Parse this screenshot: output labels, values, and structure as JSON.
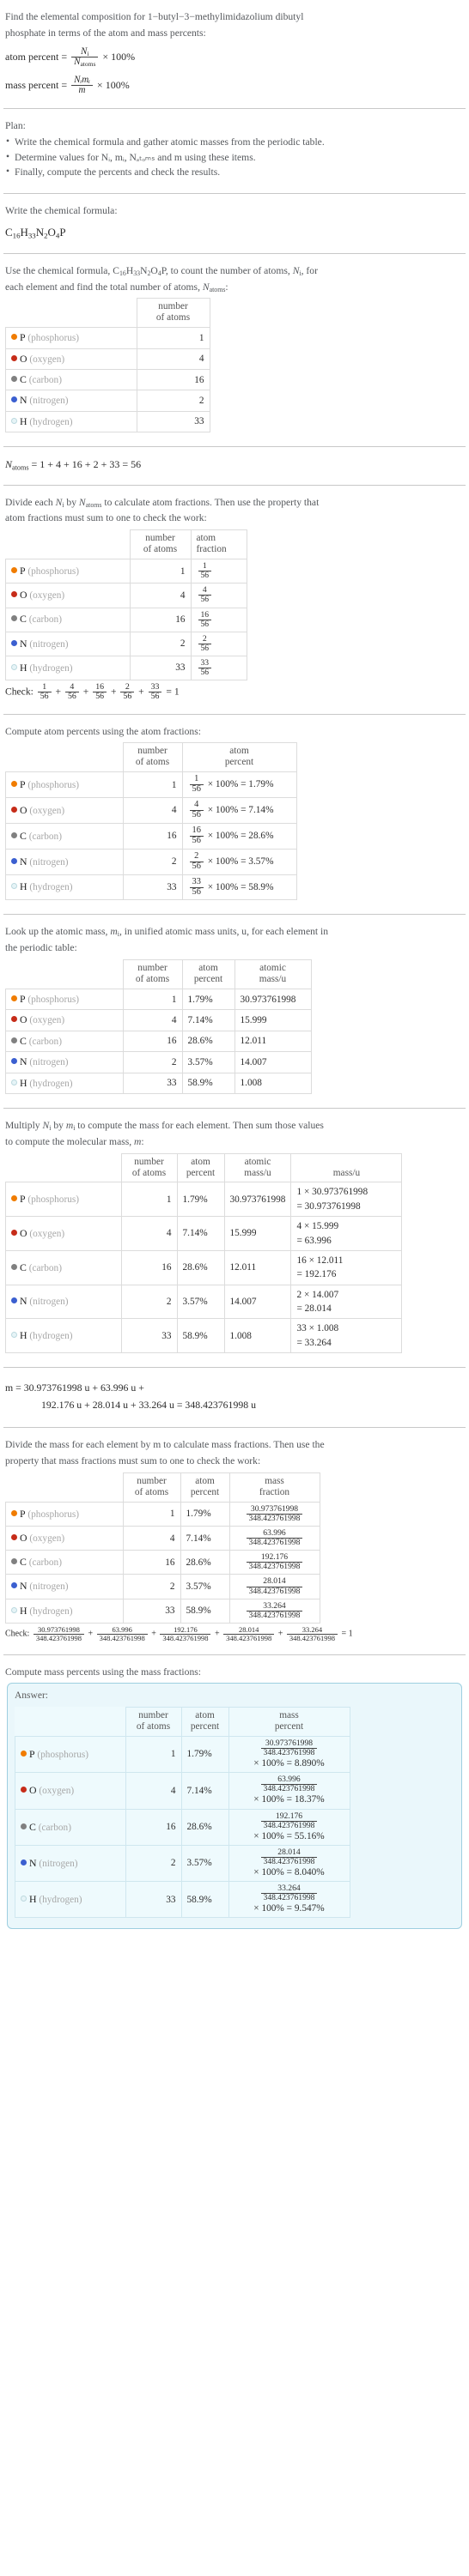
{
  "colors": {
    "phosphorus": "#f07c00",
    "oxygen": "#c62c19",
    "carbon": "#808080",
    "nitrogen": "#3b5fd0",
    "hydrogen": "#e6f4f7",
    "answer_border": "#9ecfe0",
    "answer_bg": "#eaf7fb"
  },
  "intro": {
    "line1": "Find the elemental composition for 1−butyl−3−methylimidazolium dibutyl",
    "line2": "phosphate in terms of the atom and mass percents:",
    "atom_percent_label": "atom percent",
    "mass_percent_label": "mass percent",
    "atom_percent_num": "N",
    "atom_percent_num_sub": "i",
    "atom_percent_den": "N",
    "atom_percent_den_sub": "atoms",
    "mass_percent_num": "Nᵢmᵢ",
    "mass_percent_den": "m",
    "times_100": "× 100%"
  },
  "plan": {
    "title": "Plan:",
    "items": [
      "Write the chemical formula and gather atomic masses from the periodic table.",
      "Determine values for Nᵢ, mᵢ, Nₐₜₒₘₛ and m using these items.",
      "Finally, compute the percents and check the results."
    ],
    "item2_parts": {
      "pre": "Determine values for ",
      "a": "N",
      "a_sub": "i",
      "b": "m",
      "b_sub": "i",
      "c": "N",
      "c_sub": "atoms",
      "mid": " and ",
      "d": "m",
      "post": " using these items."
    }
  },
  "formula_section": {
    "prompt": "Write the chemical formula:",
    "formula_parts": [
      {
        "el": "C",
        "n": "16"
      },
      {
        "el": "H",
        "n": "33"
      },
      {
        "el": "N",
        "n": "2"
      },
      {
        "el": "O",
        "n": "4"
      },
      {
        "el": "P",
        "n": ""
      }
    ],
    "formula_plain": "C16H33N2O4P"
  },
  "elements": [
    {
      "symbol": "P",
      "name": "(phosphorus)",
      "color": "#f07c00",
      "hollow": false,
      "count": "1",
      "fraction_num": "1",
      "atom_percent": "1.79%",
      "atomic_mass": "30.973761998",
      "mass_expr_mul": "1 × 30.973761998",
      "mass_expr_eq": "= 30.973761998",
      "mass_value": "30.973761998",
      "mass_percent_value": "8.890%"
    },
    {
      "symbol": "O",
      "name": "(oxygen)",
      "color": "#c62c19",
      "hollow": false,
      "count": "4",
      "fraction_num": "4",
      "atom_percent": "7.14%",
      "atomic_mass": "15.999",
      "mass_expr_mul": "4 × 15.999",
      "mass_expr_eq": "= 63.996",
      "mass_value": "63.996",
      "mass_percent_value": "18.37%"
    },
    {
      "symbol": "C",
      "name": "(carbon)",
      "color": "#808080",
      "hollow": false,
      "count": "16",
      "fraction_num": "16",
      "atom_percent": "28.6%",
      "atomic_mass": "12.011",
      "mass_expr_mul": "16 × 12.011",
      "mass_expr_eq": "= 192.176",
      "mass_value": "192.176",
      "mass_percent_value": "55.16%"
    },
    {
      "symbol": "N",
      "name": "(nitrogen)",
      "color": "#3b5fd0",
      "hollow": false,
      "count": "2",
      "fraction_num": "2",
      "atom_percent": "3.57%",
      "atomic_mass": "14.007",
      "mass_expr_mul": "2 × 14.007",
      "mass_expr_eq": "= 28.014",
      "mass_value": "28.014",
      "mass_percent_value": "8.040%"
    },
    {
      "symbol": "H",
      "name": "(hydrogen)",
      "color": "#e6f4f7",
      "hollow": true,
      "count": "33",
      "fraction_num": "33",
      "atom_percent": "58.9%",
      "atomic_mass": "1.008",
      "mass_expr_mul": "33 × 1.008",
      "mass_expr_eq": "= 33.264",
      "mass_value": "33.264",
      "mass_percent_value": "9.547%"
    }
  ],
  "denominator_atoms": "56",
  "total_mass": "348.423761998",
  "headers": {
    "number_of_atoms_l1": "number",
    "number_of_atoms_l2": "of atoms",
    "atom_fraction_l1": "atom",
    "atom_fraction_l2": "fraction",
    "atom_percent_l1": "atom",
    "atom_percent_l2": "percent",
    "atomic_mass_l1": "atomic",
    "atomic_mass_l2": "mass/u",
    "mass_u": "mass/u",
    "mass_fraction_l1": "mass",
    "mass_fraction_l2": "fraction",
    "mass_percent_l1": "mass",
    "mass_percent_l2": "percent"
  },
  "sections": {
    "count_prompt_l1": "Use the chemical formula, C16H33N2O4P, to count the number of atoms, Nᵢ, for",
    "count_prompt_l2": "each element and find the total number of atoms, Nₐₜₒₘₛ:",
    "natoms_sum": "Nₐₜₒₘₛ = 1 + 4 + 16 + 2 + 33 = 56",
    "natoms_sum_rhs": "= 1 + 4 + 16 + 2 + 33 = 56",
    "fraction_prompt_l1": "Divide each Nᵢ by Nₐₜₒₘₛ to calculate atom fractions. Then use the property that",
    "fraction_prompt_l2": "atom fractions must sum to one to check the work:",
    "check_label": "Check:",
    "check_result": "= 1",
    "atom_percent_prompt": "Compute atom percents using the atom fractions:",
    "mass_lookup_l1": "Look up the atomic mass, mᵢ, in unified atomic mass units, u, for each element in",
    "mass_lookup_l2": "the periodic table:",
    "multiply_l1": "Multiply Nᵢ by mᵢ to compute the mass for each element. Then sum those values",
    "multiply_l2": "to compute the molecular mass, m:",
    "m_sum_line1": "m = 30.973761998 u + 63.996 u +",
    "m_sum_line2": "192.176 u + 28.014 u + 33.264 u = 348.423761998 u",
    "mass_fraction_l1": "Divide the mass for each element by m to calculate mass fractions. Then use the",
    "mass_fraction_l2": "property that mass fractions must sum to one to check the work:",
    "mass_percent_prompt": "Compute mass percents using the mass fractions:",
    "answer_label": "Answer:"
  },
  "operators": {
    "plus": "+",
    "equals": "=",
    "times100": "× 100%",
    "times": "×"
  }
}
